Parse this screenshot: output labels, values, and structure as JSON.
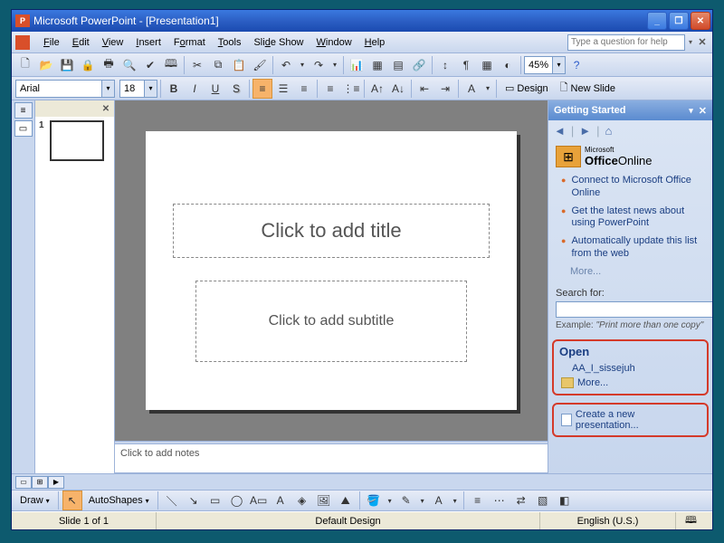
{
  "title_bar": {
    "text": "Microsoft PowerPoint - [Presentation1]"
  },
  "menu": {
    "items": [
      "File",
      "Edit",
      "View",
      "Insert",
      "Format",
      "Tools",
      "Slide Show",
      "Window",
      "Help"
    ],
    "help_placeholder": "Type a question for help"
  },
  "toolbar1": {
    "zoom": "45%"
  },
  "format_bar": {
    "font": "Arial",
    "size": "18",
    "design_label": "Design",
    "new_slide_label": "New Slide"
  },
  "thumb": {
    "number": "1"
  },
  "slide": {
    "title_placeholder": "Click to add title",
    "subtitle_placeholder": "Click to add subtitle"
  },
  "notes": {
    "placeholder": "Click to add notes"
  },
  "task_pane": {
    "header": "Getting Started",
    "office_online": {
      "prefix": "Microsoft",
      "brand": "Office",
      "suffix": "Online"
    },
    "links": [
      "Connect to Microsoft Office Online",
      "Get the latest news about using PowerPoint",
      "Automatically update this list from the web"
    ],
    "more": "More...",
    "search_label": "Search for:",
    "example_label": "Example:",
    "example_text": "\"Print more than one copy\"",
    "open": {
      "title": "Open",
      "recent": "AA_I_sissejuh",
      "more": "More..."
    },
    "create_new": "Create a new presentation..."
  },
  "draw_bar": {
    "draw": "Draw",
    "autoshapes": "AutoShapes"
  },
  "status": {
    "slide": "Slide 1 of 1",
    "design": "Default Design",
    "language": "English (U.S.)"
  }
}
